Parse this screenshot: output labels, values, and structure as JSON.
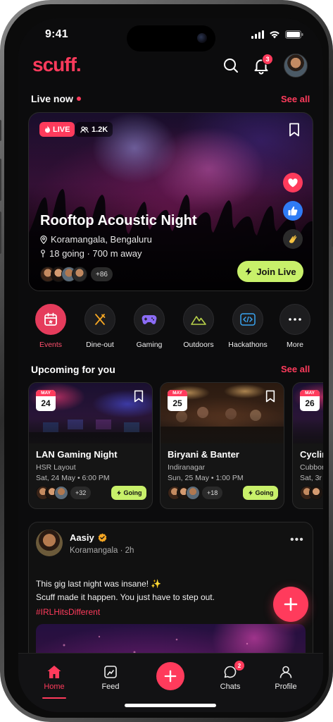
{
  "status": {
    "time": "9:41"
  },
  "app": {
    "logo": "scuff."
  },
  "header": {
    "notifications_count": "3"
  },
  "live_section": {
    "title": "Live now",
    "see_all": "See all"
  },
  "hero": {
    "live_label": "LIVE",
    "viewers": "1.2K",
    "title": "Rooftop Acoustic Night",
    "location": "Koramangala, Bengaluru",
    "meta": "18 going · 700 m away",
    "extra_count": "+86",
    "join_label": "Join Live",
    "reactions": [
      "heart-icon",
      "thumbs-up-icon",
      "clap-icon"
    ]
  },
  "categories": [
    {
      "label": "Events",
      "icon": "calendar-icon",
      "active": true
    },
    {
      "label": "Dine-out",
      "icon": "utensils-icon"
    },
    {
      "label": "Gaming",
      "icon": "gamepad-icon"
    },
    {
      "label": "Outdoors",
      "icon": "mountain-icon"
    },
    {
      "label": "Hackathons",
      "icon": "code-icon"
    },
    {
      "label": "More",
      "icon": "more-icon"
    }
  ],
  "upcoming_section": {
    "title": "Upcoming for you",
    "see_all": "See all"
  },
  "events": [
    {
      "month": "MAY",
      "day": "24",
      "title": "LAN Gaming Night",
      "place": "HSR Layout",
      "when": "Sat, 24 May • 6:00 PM",
      "count": "+32",
      "going": "Going"
    },
    {
      "month": "MAY",
      "day": "25",
      "title": "Biryani & Banter",
      "place": "Indiranagar",
      "when": "Sun, 25 May • 1:00 PM",
      "count": "+18",
      "going": "Going"
    },
    {
      "month": "MAY",
      "day": "26",
      "title": "Cyclin",
      "place": "Cubbon",
      "when": "Sat, 3r"
    }
  ],
  "post": {
    "author": "Aasiy",
    "meta": "Koramangala · 2h",
    "line1": "This gig last night was insane! ✨",
    "line2": "Scuff made it happen. You just have to step out.",
    "tag": "#IRLHitsDifferent"
  },
  "tabbar": {
    "home": "Home",
    "feed": "Feed",
    "chats": "Chats",
    "chats_badge": "2",
    "profile": "Profile"
  },
  "colors": {
    "accent": "#ff3b5c",
    "lime": "#c8f06a",
    "background": "#0c0c0d"
  }
}
